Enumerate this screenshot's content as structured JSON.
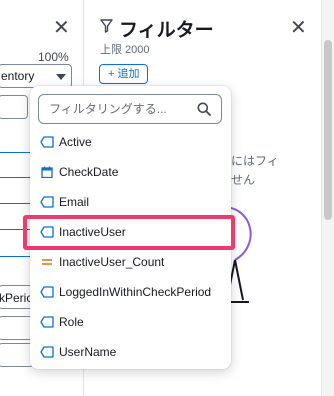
{
  "left_panel": {
    "close_label": "✕",
    "zoom": "100%",
    "dataset_select": "entory",
    "field_text": "kPeric"
  },
  "right_panel": {
    "title": "フィルター",
    "close_label": "✕",
    "limit": "上限 2000",
    "add_label": "+ 追加",
    "empty_line1": "にはフィ",
    "empty_line2": "せん"
  },
  "dropdown": {
    "search_placeholder": "フィルタリングする...",
    "items": [
      {
        "label": "Active",
        "icon": "tag-icon"
      },
      {
        "label": "CheckDate",
        "icon": "calendar-icon"
      },
      {
        "label": "Email",
        "icon": "tag-icon"
      },
      {
        "label": "InactiveUser",
        "icon": "tag-icon"
      },
      {
        "label": "InactiveUser_Count",
        "icon": "measure-icon"
      },
      {
        "label": "LoggedInWithinCheckPeriod",
        "icon": "tag-icon"
      },
      {
        "label": "Role",
        "icon": "tag-icon"
      },
      {
        "label": "UserName",
        "icon": "tag-icon"
      }
    ]
  },
  "colors": {
    "accent": "#0972d3",
    "measure": "#e07700",
    "highlight": "#ee3b6f",
    "illustration": "#8d5bd6"
  }
}
